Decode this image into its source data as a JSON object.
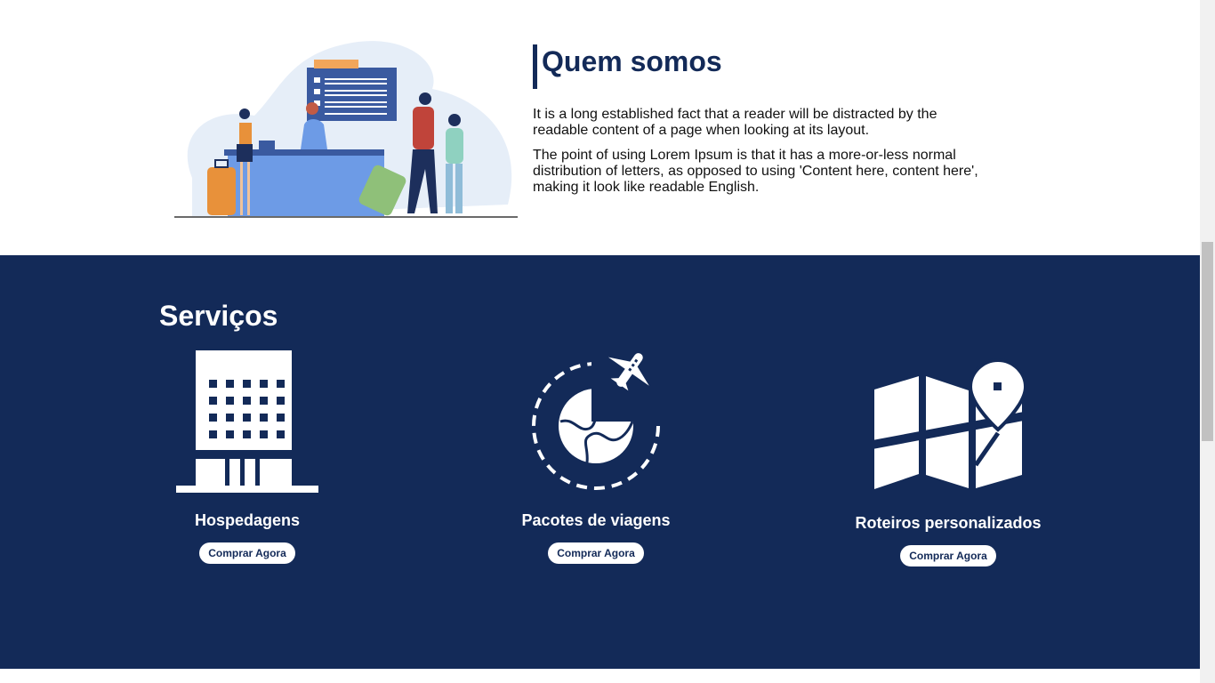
{
  "about": {
    "title": "Quem somos",
    "paragraphs": [
      "It is a long established fact that a reader will be distracted by the readable content of a page when looking at its layout.",
      "The point of using Lorem Ipsum is that it has a more-or-less normal distribution of letters, as opposed to using 'Content here, content here', making it look like readable English."
    ],
    "illustration": "airport-checkin-illustration"
  },
  "services": {
    "title": "Serviços",
    "items": [
      {
        "label": "Hospedagens",
        "button": "Comprar Agora",
        "icon": "hotel-icon"
      },
      {
        "label": "Pacotes de viagens",
        "button": "Comprar Agora",
        "icon": "globe-airplane-icon"
      },
      {
        "label": "Roteiros personalizados",
        "button": "Comprar Agora",
        "icon": "map-pin-icon"
      }
    ]
  },
  "colors": {
    "brand_navy": "#132a58",
    "background": "#ffffff"
  }
}
